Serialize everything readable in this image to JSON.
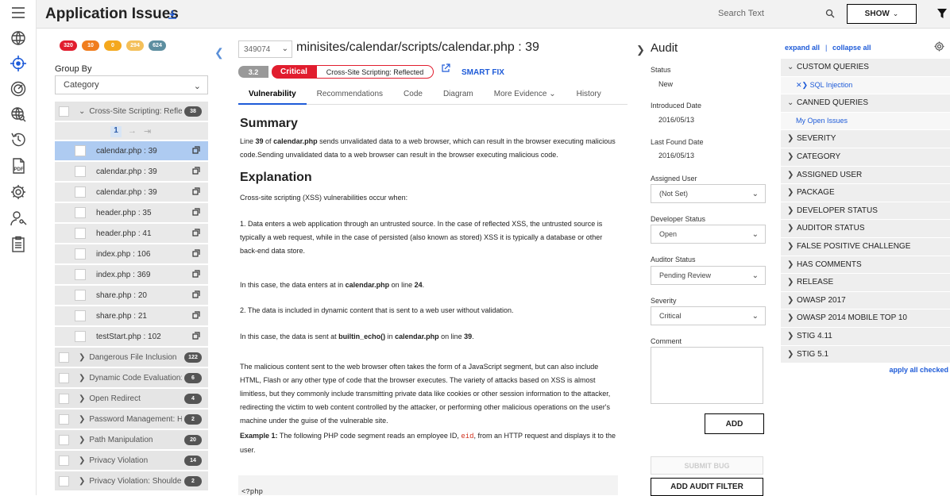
{
  "header": {
    "title": "Application Issues",
    "search_placeholder": "Search Text",
    "show_label": "SHOW"
  },
  "rail": {
    "icons": [
      "menu-icon",
      "globe-icon",
      "crosshair-icon",
      "gauge-icon",
      "globe-search-icon",
      "history-icon",
      "pdf-icon",
      "settings-icon",
      "user-key-icon",
      "clipboard-icon"
    ],
    "active": "crosshair-icon"
  },
  "severity_counts": [
    {
      "label": "320",
      "color": "#e11d2e"
    },
    {
      "label": "10",
      "color": "#f07d1e"
    },
    {
      "label": "0",
      "color": "#f4a81d"
    },
    {
      "label": "294",
      "color": "#f4c05a"
    },
    {
      "label": "624",
      "color": "#5d8ea0"
    }
  ],
  "group_by": {
    "label": "Group By",
    "value": "Category"
  },
  "issue_list": {
    "expanded_group": {
      "label": "Cross-Site Scripting: Reflec...",
      "count": "38"
    },
    "page": "1",
    "files": [
      {
        "name": "calendar.php : 39",
        "selected": true
      },
      {
        "name": "calendar.php : 39",
        "selected": false
      },
      {
        "name": "calendar.php : 39",
        "selected": false
      },
      {
        "name": "header.php : 35",
        "selected": false
      },
      {
        "name": "header.php : 41",
        "selected": false
      },
      {
        "name": "index.php : 106",
        "selected": false
      },
      {
        "name": "index.php : 369",
        "selected": false
      },
      {
        "name": "share.php : 20",
        "selected": false
      },
      {
        "name": "share.php : 21",
        "selected": false
      },
      {
        "name": "testStart.php : 102",
        "selected": false
      }
    ],
    "groups": [
      {
        "label": "Dangerous File Inclusion",
        "count": "122"
      },
      {
        "label": "Dynamic Code Evaluation: ...",
        "count": "6"
      },
      {
        "label": "Open Redirect",
        "count": "4"
      },
      {
        "label": "Password Management: H...",
        "count": "2"
      },
      {
        "label": "Path Manipulation",
        "count": "20"
      },
      {
        "label": "Privacy Violation",
        "count": "14"
      },
      {
        "label": "Privacy Violation: Shoulder...",
        "count": "2"
      }
    ]
  },
  "detail": {
    "issue_id": "349074",
    "file_path": "minisites/calendar/scripts/calendar.php : 39",
    "score": "3.2",
    "severity": "Critical",
    "category": "Cross-Site Scripting: Reflected",
    "smart_fix": "SMART FIX",
    "tabs": [
      "Vulnerability",
      "Recommendations",
      "Code",
      "Diagram",
      "More Evidence",
      "History"
    ],
    "summary_heading": "Summary",
    "summary": {
      "p1": "Line ",
      "line": "39",
      "p2": " of ",
      "file": "calendar.php",
      "p3": " sends unvalidated data to a web browser, which can result in the browser executing malicious code.Sending unvalidated data to a web browser can result in the browser executing malicious code."
    },
    "explanation_heading": "Explanation",
    "explanation_intro": "Cross-site scripting (XSS) vulnerabilities occur when:",
    "explanation_p1": "1. Data enters a web application through an untrusted source. In the case of reflected XSS, the untrusted source is typically a web request, while in the case of persisted (also known as stored) XSS it is typically a database or other back-end data store.",
    "enters": {
      "pre": "In this case, the data enters at in ",
      "file": "calendar.php",
      "mid": " on line ",
      "line": "24",
      "post": "."
    },
    "explanation_p2": "2. The data is included in dynamic content that is sent to a web user without validation.",
    "sent": {
      "pre": "In this case, the data is sent at ",
      "fn": "builtin_echo()",
      "mid": " in ",
      "file": "calendar.php",
      "mid2": " on line ",
      "line": "39",
      "post": "."
    },
    "explanation_p3": "The malicious content sent to the web browser often takes the form of a JavaScript segment, but can also include HTML, Flash or any other type of code that the browser executes. The variety of attacks based on XSS is almost limitless, but they commonly include transmitting private data like cookies or other session information to the attacker, redirecting the victim to web content controlled by the attacker, or performing other malicious operations on the user's machine under the guise of the vulnerable site.",
    "example": {
      "label": "Example 1:",
      "pre": " The following PHP code segment reads an employee ID, ",
      "code": "eid",
      "post": ", from an HTTP request and displays it to the user."
    },
    "code_snippet": "<?php"
  },
  "audit": {
    "title": "Audit",
    "status_label": "Status",
    "status": "New",
    "introduced_label": "Introduced Date",
    "introduced": "2016/05/13",
    "last_found_label": "Last Found Date",
    "last_found": "2016/05/13",
    "assigned_label": "Assigned User",
    "assigned": "(Not Set)",
    "dev_status_label": "Developer Status",
    "dev_status": "Open",
    "auditor_status_label": "Auditor Status",
    "auditor_status": "Pending Review",
    "severity_label": "Severity",
    "severity": "Critical",
    "comment_label": "Comment",
    "add": "ADD",
    "submit_bug": "SUBMIT BUG",
    "add_audit_filter": "ADD AUDIT FILTER"
  },
  "filters": {
    "expand_all": "expand all",
    "separator": "|",
    "collapse_all": "collapse all",
    "rows": [
      {
        "label": "CUSTOM QUERIES",
        "open": true,
        "sub": false
      },
      {
        "label": "SQL Injection",
        "open": false,
        "sub": true
      },
      {
        "label": "CANNED QUERIES",
        "open": true,
        "sub": false
      },
      {
        "label": "My Open Issues",
        "open": false,
        "sub": true
      },
      {
        "label": "SEVERITY",
        "open": false,
        "sub": false
      },
      {
        "label": "CATEGORY",
        "open": false,
        "sub": false
      },
      {
        "label": "ASSIGNED USER",
        "open": false,
        "sub": false
      },
      {
        "label": "PACKAGE",
        "open": false,
        "sub": false
      },
      {
        "label": "DEVELOPER STATUS",
        "open": false,
        "sub": false
      },
      {
        "label": "AUDITOR STATUS",
        "open": false,
        "sub": false
      },
      {
        "label": "FALSE POSITIVE CHALLENGE",
        "open": false,
        "sub": false
      },
      {
        "label": "HAS COMMENTS",
        "open": false,
        "sub": false
      },
      {
        "label": "RELEASE",
        "open": false,
        "sub": false
      },
      {
        "label": "OWASP 2017",
        "open": false,
        "sub": false
      },
      {
        "label": "OWASP 2014 MOBILE TOP 10",
        "open": false,
        "sub": false
      },
      {
        "label": "STIG 4.11",
        "open": false,
        "sub": false
      },
      {
        "label": "STIG 5.1",
        "open": false,
        "sub": false
      }
    ],
    "apply_all_checked": "apply all checked"
  }
}
